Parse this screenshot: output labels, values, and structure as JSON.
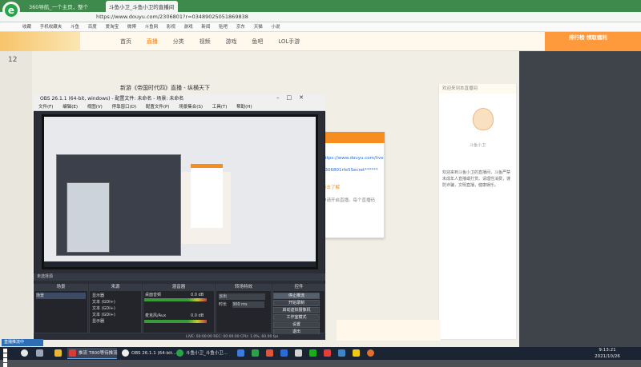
{
  "browser": {
    "tabs": [
      {
        "label": "360导航_一个主页，整个世界"
      },
      {
        "label": "斗鱼小卫_斗鱼小卫的直播间"
      }
    ],
    "url": "https://www.douyu.com/2306801?r=03489025051869838",
    "bookmarks": [
      "收藏",
      "手机收藏夹",
      "斗鱼",
      "百度",
      "爱淘宝",
      "微博",
      "斗鱼网",
      "影视",
      "游戏",
      "新闻",
      "贴吧",
      "京东",
      "天猫",
      "小说"
    ]
  },
  "douyu": {
    "nav": [
      "首页",
      "直播",
      "分类",
      "视频",
      "游戏",
      "鱼吧",
      "LOL手游"
    ],
    "level": "12",
    "room_title": "新游《帝国时代四》直播 - 纵横天下",
    "chat_header": "欢迎来到本直播间",
    "chat_message": "欢迎来到斗鱼小卫的直播间，斗鱼严禁未成年人直播或打赏。请理性消费，谨防诈骗，文明直播，健康娱乐。",
    "mascot_label": "斗鱼小卫",
    "right_ad": "排行榜 领取福利",
    "dialog_rows": [
      "https://www.douyu.com/live",
      "2306801rfe5Secret******",
      "点击了解",
      "申请开启直播。每个直播码"
    ]
  },
  "obs": {
    "title": "OBS 26.1.1 (64-bit, windows) - 配置文件: 未命名 - 场景: 未命名",
    "menu": [
      "文件(F)",
      "编辑(E)",
      "视图(V)",
      "停靠窗口(D)",
      "配置文件(P)",
      "场景集合(S)",
      "工具(T)",
      "帮助(H)"
    ],
    "preview_label": "未选择源",
    "dock_headers": [
      "场景",
      "来源",
      "混音器",
      "转场特效",
      "控件"
    ],
    "scenes": [
      "场景"
    ],
    "sources": [
      "显示器",
      "文本 (GDI+)",
      "文本 (GDI+)",
      "文本 (GDI+)",
      "显示器"
    ],
    "mixer": [
      {
        "name": "桌面音频",
        "db": "0.0 dB"
      },
      {
        "name": "麦克风/Aux",
        "db": "0.0 dB"
      }
    ],
    "transition": {
      "type": "淡出",
      "duration_label": "时长",
      "duration": "300 ms"
    },
    "controls": [
      "停止推流",
      "开始录制",
      "启动虚拟摄像机",
      "工作室模式",
      "设置",
      "退出"
    ],
    "status": "LIVE: 00:00:00  REC: 00:00:00  CPU: 1.0%, 60.00 fps"
  },
  "taskbar": {
    "start_tooltip": "直播推流中",
    "items": [
      "推流 T800等待推流",
      "OBS 26.1.1 (64-bit...",
      "斗鱼小卫_斗鱼小卫..."
    ],
    "time": "9:13:21",
    "date": "2021/10/26"
  },
  "colors": {
    "browser_tab": "#3e8a4c",
    "douyu_orange": "#f78c20",
    "obs_bg": "#2b2e36",
    "taskbar": "#1b2433"
  }
}
